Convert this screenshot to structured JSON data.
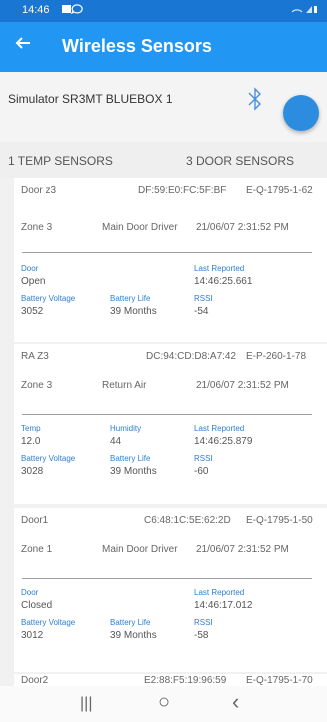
{
  "status": {
    "time": "14:46"
  },
  "header": {
    "title": "Wireless Sensors"
  },
  "device": {
    "name": "Simulator SR3MT BLUEBOX 1"
  },
  "counts": {
    "temp": "1 TEMP SENSORS",
    "door": "3 DOOR SENSORS"
  },
  "sensors": [
    {
      "name": "Door z3",
      "mac": "DF:59:E0:FC:5F:BF",
      "serial": "E-Q-1795-1-62",
      "zone": "Zone 3",
      "type": "Main Door Driver",
      "date": "21/06/07 2:31:52 PM",
      "f1_label": "Door",
      "f1_value": "Open",
      "f2_label": "",
      "f2_value": "",
      "reported_label": "Last Reported",
      "reported_value": "14:46:25.661",
      "battery_label": "Battery Voltage",
      "battery_value": "3052",
      "life_label": "Battery Life",
      "life_value": "39 Months",
      "rssi_label": "RSSI",
      "rssi_value": "-54"
    },
    {
      "name": "RA Z3",
      "mac": "DC:94:CD:D8:A7:42",
      "serial": "E-P-260-1-78",
      "zone": "Zone 3",
      "type": "Return Air",
      "date": "21/06/07 2:31:52 PM",
      "f1_label": "Temp",
      "f1_value": "12.0",
      "f2_label": "Humidity",
      "f2_value": "44",
      "reported_label": "Last Reported",
      "reported_value": "14:46:25.879",
      "battery_label": "Battery Voltage",
      "battery_value": "3028",
      "life_label": "Battery Life",
      "life_value": "39 Months",
      "rssi_label": "RSSI",
      "rssi_value": "-60"
    },
    {
      "name": "Door1",
      "mac": "C6:48:1C:5E:62:2D",
      "serial": "E-Q-1795-1-50",
      "zone": "Zone 1",
      "type": "Main Door Driver",
      "date": "21/06/07 2:31:52 PM",
      "f1_label": "Door",
      "f1_value": "Closed",
      "f2_label": "",
      "f2_value": "",
      "reported_label": "Last Reported",
      "reported_value": "14:46:17.012",
      "battery_label": "Battery Voltage",
      "battery_value": "3012",
      "life_label": "Battery Life",
      "life_value": "39 Months",
      "rssi_label": "RSSI",
      "rssi_value": "-58"
    },
    {
      "name": "Door2",
      "mac": "E2:88:F5:19:96:59",
      "serial": "E-Q-1795-1-70"
    }
  ],
  "nav": {
    "recents": "|||",
    "home": "○",
    "back": "‹"
  },
  "colors": {
    "appbar": "#2196f3",
    "statusbar": "#1976d2",
    "label": "#2b7fd4",
    "fab": "#2b8ce0"
  }
}
